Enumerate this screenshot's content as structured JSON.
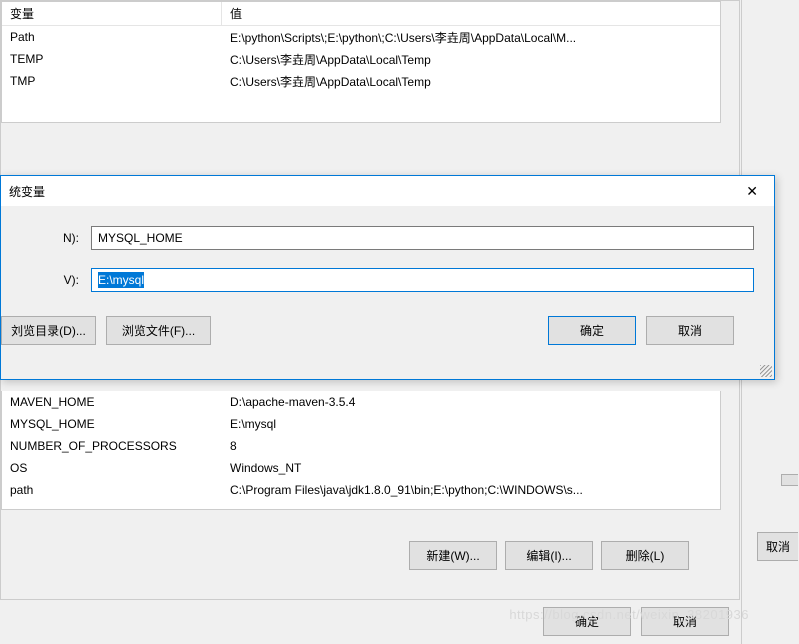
{
  "upper_table": {
    "header": {
      "col1": "变量",
      "col2": "值"
    },
    "rows": [
      {
        "name": "Path",
        "value": "E:\\python\\Scripts\\;E:\\python\\;C:\\Users\\李垚周\\AppData\\Local\\M..."
      },
      {
        "name": "TEMP",
        "value": "C:\\Users\\李垚周\\AppData\\Local\\Temp"
      },
      {
        "name": "TMP",
        "value": "C:\\Users\\李垚周\\AppData\\Local\\Temp"
      }
    ]
  },
  "lower_table": {
    "rows": [
      {
        "name": "MAVEN_HOME",
        "value": "D:\\apache-maven-3.5.4"
      },
      {
        "name": "MYSQL_HOME",
        "value": "E:\\mysql"
      },
      {
        "name": "NUMBER_OF_PROCESSORS",
        "value": "8"
      },
      {
        "name": "OS",
        "value": "Windows_NT"
      },
      {
        "name": "path",
        "value": "C:\\Program Files\\java\\jdk1.8.0_91\\bin;E:\\python;C:\\WINDOWS\\s..."
      }
    ]
  },
  "lower_buttons": {
    "new": "新建(W)...",
    "edit": "编辑(I)...",
    "delete": "删除(L)"
  },
  "edit_dialog": {
    "title": "统变量",
    "close": "✕",
    "name_label": "N):",
    "name_value": "MYSQL_HOME",
    "value_label": "V):",
    "value_value": "E:\\mysql",
    "browse_dir": "刘览目录(D)...",
    "browse_file": "浏览文件(F)...",
    "ok": "确定",
    "cancel": "取消"
  },
  "right_panel": {
    "cancel_partial": "取消"
  },
  "bottom": {
    "ok": "确定",
    "cancel": "取消"
  },
  "watermark": "https://blog.csdn.net/weixin_38201936"
}
